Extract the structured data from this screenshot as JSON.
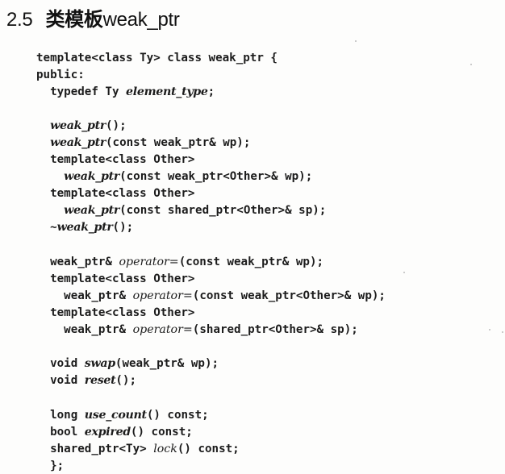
{
  "heading": {
    "number": "2.5",
    "title_cjk": "类模板",
    "title_code": "weak_ptr"
  },
  "code": {
    "lines": [
      {
        "parts": [
          {
            "t": "template<class Ty> class weak_ptr {",
            "s": "n"
          }
        ]
      },
      {
        "parts": [
          {
            "t": "public:",
            "s": "n"
          }
        ]
      },
      {
        "parts": [
          {
            "t": "  typedef Ty ",
            "s": "n"
          },
          {
            "t": "element_type",
            "s": "i"
          },
          {
            "t": ";",
            "s": "n"
          }
        ]
      },
      {
        "parts": []
      },
      {
        "parts": [
          {
            "t": "  ",
            "s": "n"
          },
          {
            "t": "weak_ptr",
            "s": "i"
          },
          {
            "t": "();",
            "s": "n"
          }
        ]
      },
      {
        "parts": [
          {
            "t": "  ",
            "s": "n"
          },
          {
            "t": "weak_ptr",
            "s": "i"
          },
          {
            "t": "(const weak_ptr& wp);",
            "s": "n"
          }
        ]
      },
      {
        "parts": [
          {
            "t": "  template<class Other>",
            "s": "n"
          }
        ]
      },
      {
        "parts": [
          {
            "t": "    ",
            "s": "n"
          },
          {
            "t": "weak_ptr",
            "s": "i"
          },
          {
            "t": "(const weak_ptr<Other>& wp);",
            "s": "n"
          }
        ]
      },
      {
        "parts": [
          {
            "t": "  template<class Other>",
            "s": "n"
          }
        ]
      },
      {
        "parts": [
          {
            "t": "    ",
            "s": "n"
          },
          {
            "t": "weak_ptr",
            "s": "i"
          },
          {
            "t": "(const shared_ptr<Other>& sp);",
            "s": "n"
          }
        ]
      },
      {
        "parts": [
          {
            "t": "  ~",
            "s": "n"
          },
          {
            "t": "weak_ptr",
            "s": "i"
          },
          {
            "t": "();",
            "s": "n"
          }
        ]
      },
      {
        "parts": []
      },
      {
        "parts": [
          {
            "t": "  weak_ptr& ",
            "s": "n"
          },
          {
            "t": "operator=",
            "s": "l"
          },
          {
            "t": "(const weak_ptr& wp);",
            "s": "n"
          }
        ]
      },
      {
        "parts": [
          {
            "t": "  template<class Other>",
            "s": "n"
          }
        ]
      },
      {
        "parts": [
          {
            "t": "    weak_ptr& ",
            "s": "n"
          },
          {
            "t": "operator=",
            "s": "l"
          },
          {
            "t": "(const weak_ptr<Other>& wp);",
            "s": "n"
          }
        ]
      },
      {
        "parts": [
          {
            "t": "  template<class Other>",
            "s": "n"
          }
        ]
      },
      {
        "parts": [
          {
            "t": "    weak_ptr& ",
            "s": "n"
          },
          {
            "t": "operator=",
            "s": "l"
          },
          {
            "t": "(shared_ptr<Other>& sp);",
            "s": "n"
          }
        ]
      },
      {
        "parts": []
      },
      {
        "parts": [
          {
            "t": "  void ",
            "s": "n"
          },
          {
            "t": "swap",
            "s": "i"
          },
          {
            "t": "(weak_ptr& wp);",
            "s": "n"
          }
        ]
      },
      {
        "parts": [
          {
            "t": "  void ",
            "s": "n"
          },
          {
            "t": "reset",
            "s": "i"
          },
          {
            "t": "();",
            "s": "n"
          }
        ]
      },
      {
        "parts": []
      },
      {
        "parts": [
          {
            "t": "  long ",
            "s": "n"
          },
          {
            "t": "use_count",
            "s": "i"
          },
          {
            "t": "() const;",
            "s": "n"
          }
        ]
      },
      {
        "parts": [
          {
            "t": "  bool ",
            "s": "n"
          },
          {
            "t": "expired",
            "s": "i"
          },
          {
            "t": "() const;",
            "s": "n"
          }
        ]
      },
      {
        "parts": [
          {
            "t": "  shared_ptr<Ty> ",
            "s": "n"
          },
          {
            "t": "lock",
            "s": "l"
          },
          {
            "t": "() const;",
            "s": "n"
          }
        ]
      },
      {
        "parts": [
          {
            "t": "  };",
            "s": "n"
          }
        ]
      }
    ]
  }
}
